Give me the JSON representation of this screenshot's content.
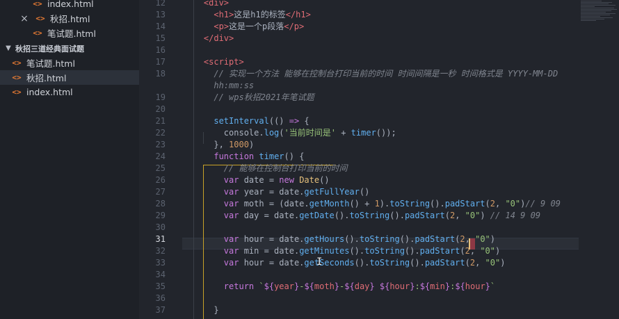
{
  "explorer": {
    "items": [
      {
        "label": "index.html",
        "type": "file"
      },
      {
        "label": "秋招.html",
        "type": "file",
        "modified": true
      },
      {
        "label": "笔试题.html",
        "type": "file"
      },
      {
        "label": "秋招三道经典面试题",
        "type": "folder"
      },
      {
        "label": "笔试题.html",
        "type": "file"
      },
      {
        "label": "秋招.html",
        "type": "file",
        "selected": true
      },
      {
        "label": "index.html",
        "type": "file"
      }
    ],
    "icons": {
      "file": "html-file-icon",
      "folder": "chevron-down-icon",
      "close": "close-icon"
    }
  },
  "editor": {
    "active_line": "31",
    "lines": [
      {
        "n": "12",
        "tokens": [
          [
            "    ",
            "p"
          ],
          [
            "<div>",
            "tag"
          ]
        ]
      },
      {
        "n": "13",
        "tokens": [
          [
            "      ",
            "p"
          ],
          [
            "<h1>",
            "tag"
          ],
          [
            "这是h1的标签",
            "p"
          ],
          [
            "</h1>",
            "tag"
          ]
        ]
      },
      {
        "n": "14",
        "tokens": [
          [
            "      ",
            "p"
          ],
          [
            "<p>",
            "tag"
          ],
          [
            "这是一个p段落",
            "p"
          ],
          [
            "</p>",
            "tag"
          ]
        ]
      },
      {
        "n": "15",
        "tokens": [
          [
            "    ",
            "p"
          ],
          [
            "</div>",
            "tag"
          ]
        ]
      },
      {
        "n": "16",
        "tokens": []
      },
      {
        "n": "17",
        "tokens": [
          [
            "    ",
            "p"
          ],
          [
            "<script>",
            "tag"
          ]
        ]
      },
      {
        "n": "18",
        "tokens": [
          [
            "      ",
            "p"
          ],
          [
            "// 实现一个方法 能够在控制台打印当前的时间 时间间隔是一秒 时间格式是 YYYY-MM-DD",
            "com"
          ]
        ]
      },
      {
        "n": "",
        "tokens": [
          [
            "      ",
            "p"
          ],
          [
            "hh:mm:ss",
            "com"
          ]
        ]
      },
      {
        "n": "19",
        "tokens": [
          [
            "      ",
            "p"
          ],
          [
            "// wps秋招2021年笔试题",
            "com"
          ]
        ]
      },
      {
        "n": "20",
        "tokens": []
      },
      {
        "n": "21",
        "tokens": [
          [
            "      ",
            "p"
          ],
          [
            "setInterval",
            "fn"
          ],
          [
            "(() ",
            "p"
          ],
          [
            "=>",
            "kw"
          ],
          [
            " {",
            "p"
          ]
        ]
      },
      {
        "n": "22",
        "tokens": [
          [
            "        ",
            "p"
          ],
          [
            "console",
            "p"
          ],
          [
            ".",
            "p"
          ],
          [
            "log",
            "fn"
          ],
          [
            "(",
            "p"
          ],
          [
            "'当前时间是'",
            "str"
          ],
          [
            " + ",
            "p"
          ],
          [
            "timer",
            "fn"
          ],
          [
            "());",
            "p"
          ]
        ]
      },
      {
        "n": "23",
        "tokens": [
          [
            "      ",
            "p"
          ],
          [
            "}, ",
            "p"
          ],
          [
            "1000",
            "num"
          ],
          [
            ")",
            "p"
          ]
        ]
      },
      {
        "n": "24",
        "tokens": [
          [
            "      ",
            "p"
          ],
          [
            "function",
            "kw"
          ],
          [
            " ",
            "p"
          ],
          [
            "timer",
            "fn"
          ],
          [
            "() {",
            "p"
          ]
        ]
      },
      {
        "n": "25",
        "tokens": [
          [
            "        ",
            "p"
          ],
          [
            "// 能够在控制台打印当前的时间",
            "com"
          ]
        ]
      },
      {
        "n": "26",
        "tokens": [
          [
            "        ",
            "p"
          ],
          [
            "var",
            "kw"
          ],
          [
            " date = ",
            "p"
          ],
          [
            "new",
            "kw"
          ],
          [
            " ",
            "p"
          ],
          [
            "Date",
            "prop"
          ],
          [
            "()",
            "p"
          ]
        ]
      },
      {
        "n": "27",
        "tokens": [
          [
            "        ",
            "p"
          ],
          [
            "var",
            "kw"
          ],
          [
            " year = date.",
            "p"
          ],
          [
            "getFullYear",
            "fn"
          ],
          [
            "()",
            "p"
          ]
        ]
      },
      {
        "n": "28",
        "tokens": [
          [
            "        ",
            "p"
          ],
          [
            "var",
            "kw"
          ],
          [
            " moth = (date.",
            "p"
          ],
          [
            "getMonth",
            "fn"
          ],
          [
            "() + ",
            "p"
          ],
          [
            "1",
            "num"
          ],
          [
            ").",
            "p"
          ],
          [
            "toString",
            "fn"
          ],
          [
            "().",
            "p"
          ],
          [
            "padStart",
            "fn"
          ],
          [
            "(",
            "p"
          ],
          [
            "2",
            "num"
          ],
          [
            ", ",
            "p"
          ],
          [
            "\"0\"",
            "str"
          ],
          [
            ")",
            "p"
          ],
          [
            "// 9 09",
            "com"
          ]
        ]
      },
      {
        "n": "29",
        "tokens": [
          [
            "        ",
            "p"
          ],
          [
            "var",
            "kw"
          ],
          [
            " day = date.",
            "p"
          ],
          [
            "getDate",
            "fn"
          ],
          [
            "().",
            "p"
          ],
          [
            "toString",
            "fn"
          ],
          [
            "().",
            "p"
          ],
          [
            "padStart",
            "fn"
          ],
          [
            "(",
            "p"
          ],
          [
            "2",
            "num"
          ],
          [
            ", ",
            "p"
          ],
          [
            "\"0\"",
            "str"
          ],
          [
            ") ",
            "p"
          ],
          [
            "// 14 9 09",
            "com"
          ]
        ]
      },
      {
        "n": "30",
        "tokens": []
      },
      {
        "n": "31",
        "tokens": [
          [
            "        ",
            "p"
          ],
          [
            "var",
            "kw"
          ],
          [
            " hour = date.",
            "p"
          ],
          [
            "getHours",
            "fn"
          ],
          [
            "().",
            "p"
          ],
          [
            "toString",
            "fn"
          ],
          [
            "().",
            "p"
          ],
          [
            "padStart",
            "fn"
          ],
          [
            "(",
            "p"
          ],
          [
            "2",
            "num"
          ],
          [
            ", ",
            "p"
          ],
          [
            "\"0\"",
            "str"
          ],
          [
            ")",
            "p"
          ]
        ]
      },
      {
        "n": "32",
        "tokens": [
          [
            "        ",
            "p"
          ],
          [
            "var",
            "kw"
          ],
          [
            " min = date.",
            "p"
          ],
          [
            "getMinutes",
            "fn"
          ],
          [
            "().",
            "p"
          ],
          [
            "toString",
            "fn"
          ],
          [
            "().",
            "p"
          ],
          [
            "padStart",
            "fn"
          ],
          [
            "(",
            "p"
          ],
          [
            "2",
            "num"
          ],
          [
            ", ",
            "p"
          ],
          [
            "\"0\"",
            "str"
          ],
          [
            ")",
            "p"
          ]
        ]
      },
      {
        "n": "33",
        "tokens": [
          [
            "        ",
            "p"
          ],
          [
            "var",
            "kw"
          ],
          [
            " hour = date.",
            "p"
          ],
          [
            "getSeconds",
            "fn"
          ],
          [
            "().",
            "p"
          ],
          [
            "toString",
            "fn"
          ],
          [
            "().",
            "p"
          ],
          [
            "padStart",
            "fn"
          ],
          [
            "(",
            "p"
          ],
          [
            "2",
            "num"
          ],
          [
            ", ",
            "p"
          ],
          [
            "\"0\"",
            "str"
          ],
          [
            ")",
            "p"
          ]
        ]
      },
      {
        "n": "34",
        "tokens": []
      },
      {
        "n": "35",
        "tokens": [
          [
            "        ",
            "p"
          ],
          [
            "return",
            "kw"
          ],
          [
            " `",
            "str"
          ],
          [
            "${",
            "tpl"
          ],
          [
            "year",
            "var"
          ],
          [
            "}",
            "tpl"
          ],
          [
            "-",
            "str"
          ],
          [
            "${",
            "tpl"
          ],
          [
            "moth",
            "var"
          ],
          [
            "}",
            "tpl"
          ],
          [
            "-",
            "str"
          ],
          [
            "${",
            "tpl"
          ],
          [
            "day",
            "var"
          ],
          [
            "}",
            "tpl"
          ],
          [
            " ",
            "str"
          ],
          [
            "${",
            "tpl"
          ],
          [
            "hour",
            "var"
          ],
          [
            "}",
            "tpl"
          ],
          [
            ":",
            "str"
          ],
          [
            "${",
            "tpl"
          ],
          [
            "min",
            "var"
          ],
          [
            "}",
            "tpl"
          ],
          [
            ":",
            "str"
          ],
          [
            "${",
            "tpl"
          ],
          [
            "hour",
            "var"
          ],
          [
            "}",
            "tpl"
          ],
          [
            "`",
            "str"
          ]
        ]
      },
      {
        "n": "36",
        "tokens": []
      },
      {
        "n": "37",
        "tokens": [
          [
            "      ",
            "p"
          ],
          [
            "}",
            "p"
          ]
        ]
      }
    ]
  }
}
